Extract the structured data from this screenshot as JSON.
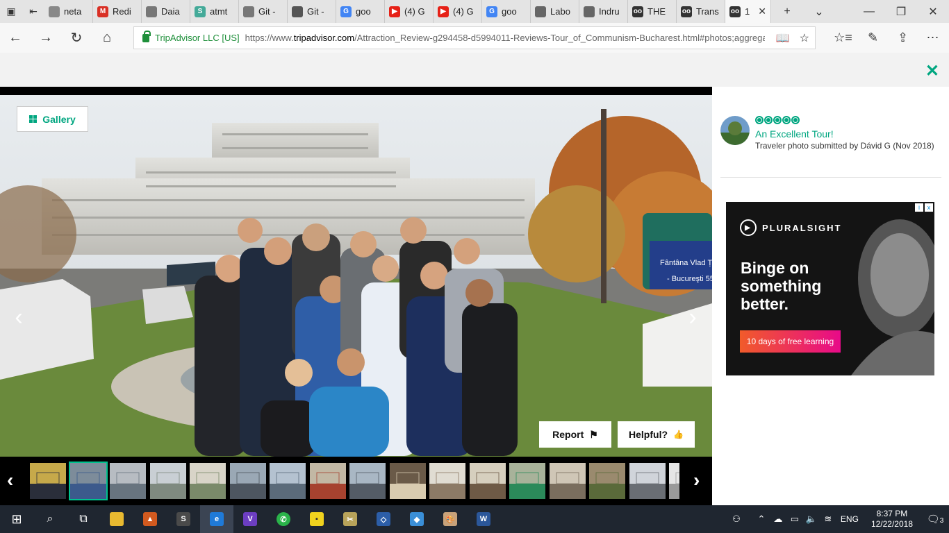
{
  "browser": {
    "tabs": [
      {
        "label": "neta",
        "color": "#888"
      },
      {
        "label": "Redi",
        "color": "#d93025",
        "glyph": "M"
      },
      {
        "label": "Daia",
        "color": "#777"
      },
      {
        "label": "atmt",
        "color": "#4a9",
        "glyph": "S"
      },
      {
        "label": "Git -",
        "color": "#777"
      },
      {
        "label": "Git -",
        "color": "#555"
      },
      {
        "label": "goo",
        "color": "#4285f4",
        "glyph": "G"
      },
      {
        "label": "(4) G",
        "color": "#e62117",
        "glyph": "▶"
      },
      {
        "label": "(4) G",
        "color": "#e62117",
        "glyph": "▶"
      },
      {
        "label": "goo",
        "color": "#4285f4",
        "glyph": "G"
      },
      {
        "label": "Labo",
        "color": "#666"
      },
      {
        "label": "Indru",
        "color": "#666"
      },
      {
        "label": "THE",
        "color": "#333",
        "glyph": "oo"
      },
      {
        "label": "Trans",
        "color": "#333",
        "glyph": "oo"
      },
      {
        "label": "1",
        "color": "#333",
        "glyph": "oo",
        "active": true
      }
    ],
    "new_tab": "+",
    "tab_menu": "⌄",
    "window": {
      "minimize": "—",
      "maximize": "❐",
      "close": "✕"
    },
    "back": "←",
    "forward": "→",
    "refresh": "↻",
    "home": "⌂",
    "site_identity": "TripAdvisor LLC [US]",
    "url_prefix": "https://www.",
    "url_domain": "tripadvisor.com",
    "url_path": "/Attraction_Review-g294458-d5994011-Reviews-Tour_of_Communism-Bucharest.html#photos;aggrega",
    "reading_view": "📖",
    "favorite": "☆",
    "favorites_hub": "☆≡",
    "pen": "✎",
    "share": "⇪",
    "more": "⋯"
  },
  "viewer": {
    "close": "✕",
    "gallery_label": "Gallery",
    "prev": "‹",
    "next": "›",
    "report_label": "Report",
    "helpful_label": "Helpful?",
    "flag_glyph": "⚑",
    "thumb_glyph": "👍"
  },
  "review": {
    "bubbles": 5,
    "title": "An Excellent Tour!",
    "submitted": "Traveler photo submitted by Dávid G (Nov 2018)"
  },
  "ad": {
    "brand": "PLURALSIGHT",
    "headline": "Binge on something better.",
    "cta": "10 days of free learning",
    "choice_i": "i",
    "choice_x": "x"
  },
  "taskbar": {
    "lang": "ENG",
    "time": "8:37 PM",
    "date": "12/22/2018",
    "notifications": "3"
  }
}
